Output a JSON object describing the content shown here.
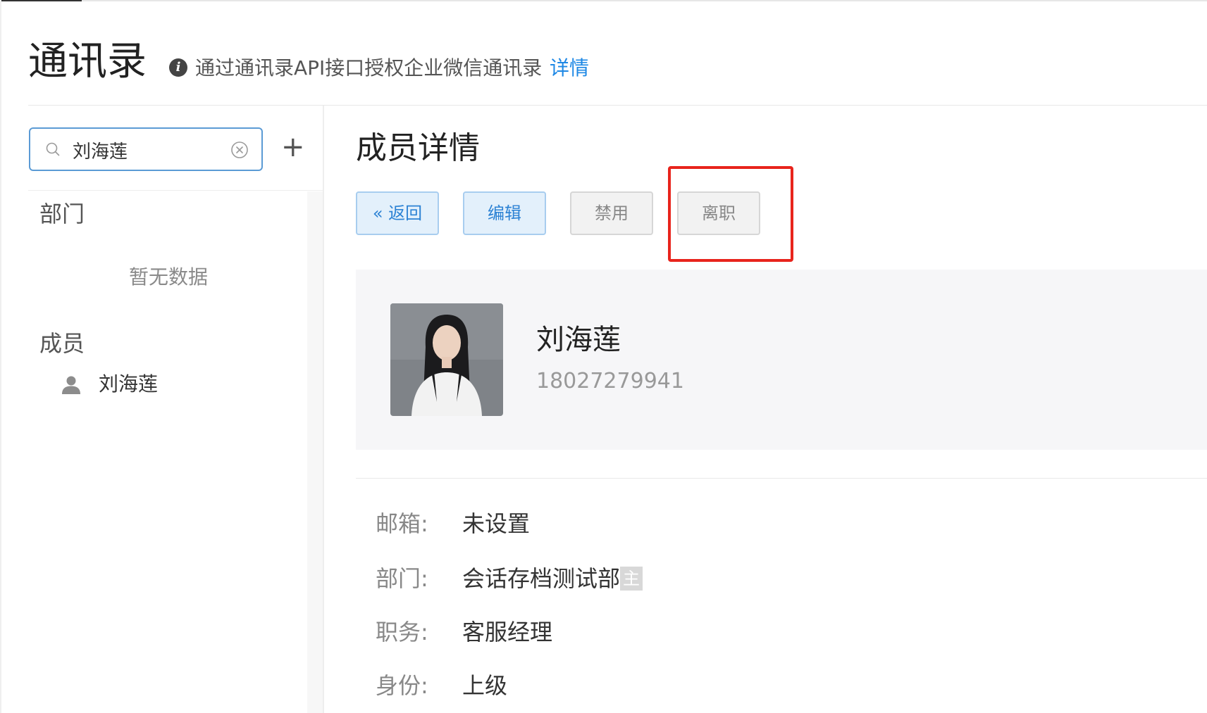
{
  "header": {
    "title": "通讯录",
    "info_icon": "info-circle-icon",
    "subtitle": "通过通讯录API接口授权企业微信通讯录",
    "detail_link": "详情"
  },
  "sidebar": {
    "search": {
      "value": "刘海莲",
      "search_icon": "search-icon",
      "clear_icon": "clear-circle-icon"
    },
    "add_label": "+",
    "department_section": "部门",
    "department_empty": "暂无数据",
    "member_section": "成员",
    "members": [
      {
        "name": "刘海莲",
        "icon": "person-icon"
      }
    ]
  },
  "detail": {
    "title": "成员详情",
    "buttons": {
      "back": "« 返回",
      "edit": "编辑",
      "disable": "禁用",
      "resign": "离职"
    },
    "highlight_color": "#e8241c",
    "profile": {
      "name": "刘海莲",
      "phone": "18027279941"
    },
    "fields": [
      {
        "label": "邮箱:",
        "value": "未设置"
      },
      {
        "label": "部门:",
        "value": "会话存档测试部",
        "badge": "主"
      },
      {
        "label": "职务:",
        "value": "客服经理"
      },
      {
        "label": "身份:",
        "value": "上级"
      }
    ]
  },
  "colors": {
    "accent": "#1e88e5",
    "button_blue_bg": "#e3f0fb",
    "button_gray_bg": "#f2f2f2",
    "card_bg": "#f6f6f8"
  }
}
